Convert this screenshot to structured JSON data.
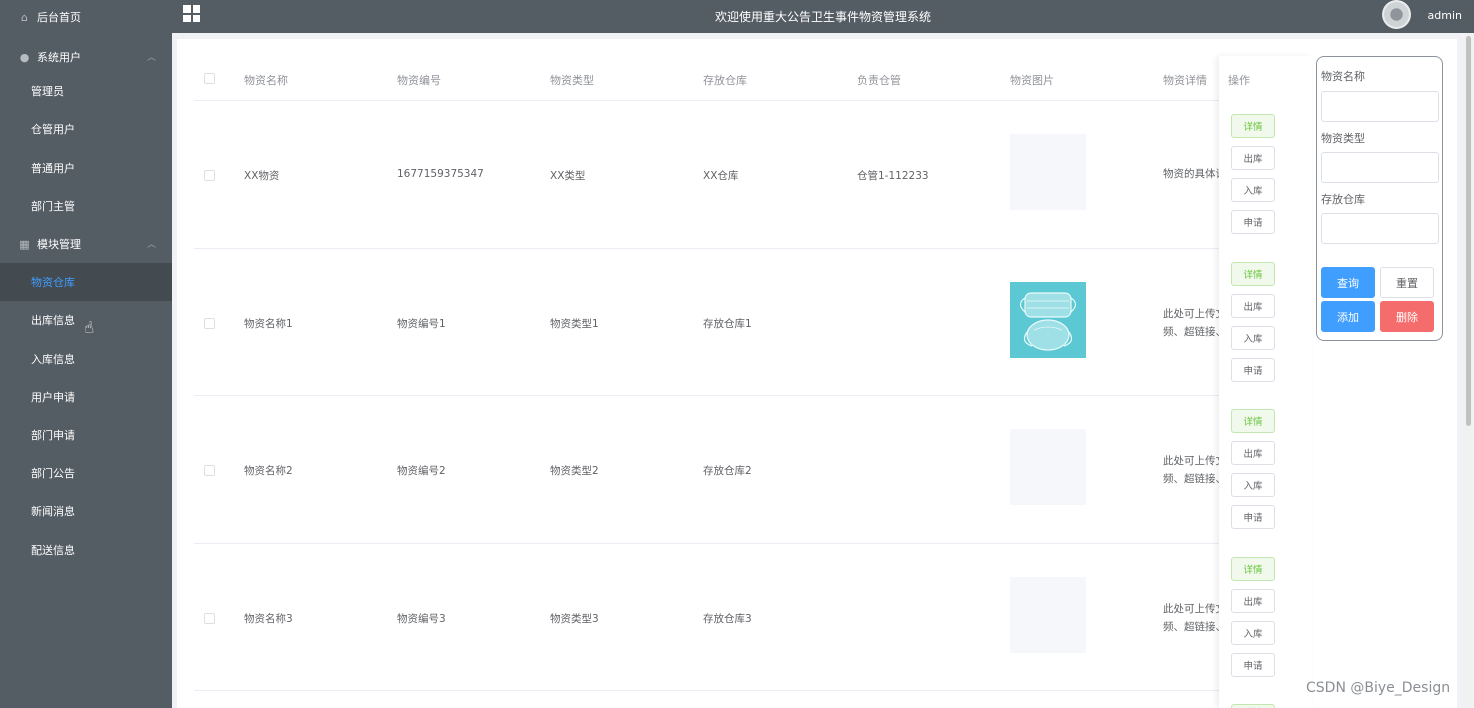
{
  "sidebar": {
    "home": "后台首页",
    "sys_users": "系统用户",
    "sys_users_items": [
      "管理员",
      "仓管用户",
      "普通用户",
      "部门主管"
    ],
    "module_mgmt": "模块管理",
    "module_items": [
      "物资仓库",
      "出库信息",
      "入库信息",
      "用户申请",
      "部门申请",
      "部门公告",
      "新闻消息",
      "配送信息"
    ],
    "active_item": "物资仓库"
  },
  "header": {
    "title": "欢迎使用重大公告卫生事件物资管理系统",
    "user": "admin"
  },
  "table": {
    "columns": [
      "物资名称",
      "物资编号",
      "物资类型",
      "存放仓库",
      "负责仓管",
      "物资图片",
      "物资详情",
      "操作"
    ],
    "rows": [
      {
        "name": "XX物资",
        "code": "1677159375347",
        "type": "XX类型",
        "warehouse": "XX仓库",
        "keeper": "仓管1-112233",
        "image": "placeholder",
        "detail_line1": "物资的具体详",
        "detail_line2": ""
      },
      {
        "name": "物资名称1",
        "code": "物资编号1",
        "type": "物资类型1",
        "warehouse": "存放仓库1",
        "keeper": "",
        "image": "mask-photo",
        "detail_line1": "此处可上传文",
        "detail_line2": "频、超链接、"
      },
      {
        "name": "物资名称2",
        "code": "物资编号2",
        "type": "物资类型2",
        "warehouse": "存放仓库2",
        "keeper": "",
        "image": "placeholder",
        "detail_line1": "此处可上传文",
        "detail_line2": "频、超链接、"
      },
      {
        "name": "物资名称3",
        "code": "物资编号3",
        "type": "物资类型3",
        "warehouse": "存放仓库3",
        "keeper": "",
        "image": "placeholder",
        "detail_line1": "此处可上传文",
        "detail_line2": "频、超链接、"
      }
    ],
    "row_actions": [
      "详情",
      "出库",
      "入库",
      "申请"
    ],
    "next_row_action": "详情"
  },
  "search": {
    "label_name": "物资名称",
    "label_type": "物资类型",
    "label_warehouse": "存放仓库",
    "btn_query": "查询",
    "btn_reset": "重置",
    "btn_add": "添加",
    "btn_delete": "删除"
  },
  "watermark": "CSDN @Biye_Design",
  "colors": {
    "sidebar_bg": "#545c64",
    "active_text": "#409eff",
    "primary": "#409eff",
    "danger": "#f56c6c",
    "success": "#67c23a"
  }
}
